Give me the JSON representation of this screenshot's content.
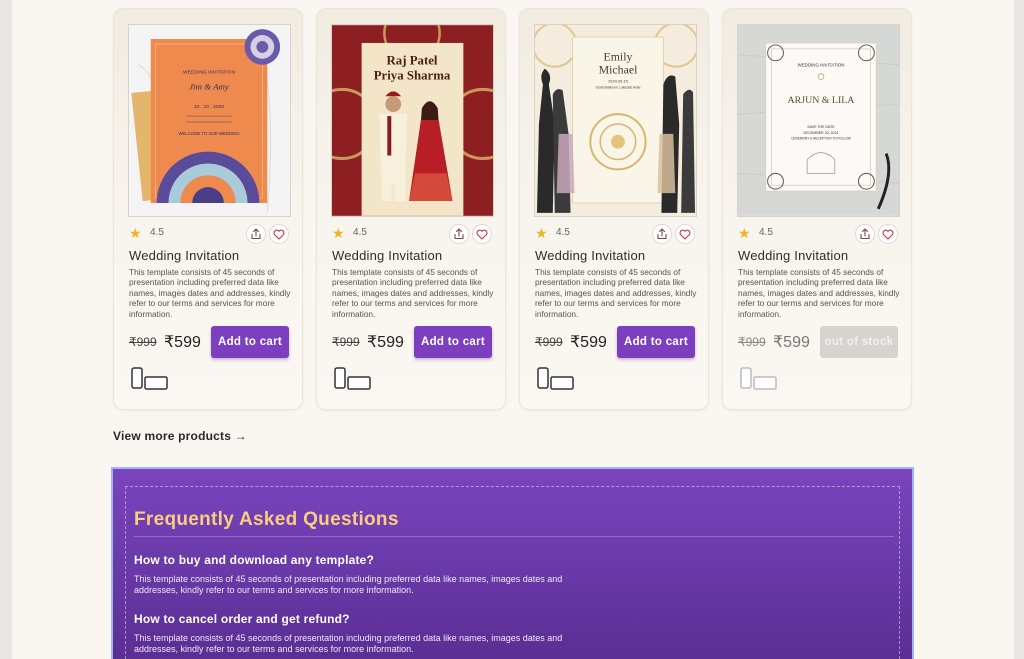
{
  "products": [
    {
      "rating": "4.5",
      "title": "Wedding Invitation",
      "description": "This template consists of 45 seconds of presentation including preferred data like names, images dates and addresses, kindly refer to our terms and services for more information.",
      "old_price": "₹999",
      "price": "₹599",
      "button_label": "Add to cart",
      "available": true,
      "thumb": {
        "heading": "WEDDING INVITATION",
        "names": "Jim & Amy",
        "date": "10 . 10 . 2020",
        "footer": "WELCOME TO OUR WEDDING"
      }
    },
    {
      "rating": "4.5",
      "title": "Wedding Invitation",
      "description": "This template consists of 45 seconds of presentation including preferred data like names, images dates and addresses, kindly refer to our terms and services for more information.",
      "old_price": "₹999",
      "price": "₹599",
      "button_label": "Add to cart",
      "available": true,
      "thumb": {
        "name1": "Raj Patel",
        "name2": "Priya Sharma"
      }
    },
    {
      "rating": "4.5",
      "title": "Wedding Invitation",
      "description": "This template consists of 45 seconds of presentation including preferred data like names, images dates and addresses, kindly refer to our terms and services for more information.",
      "old_price": "₹999",
      "price": "₹599",
      "button_label": "Add to cart",
      "available": true,
      "thumb": {
        "name1": "Emily",
        "name2": "Michael",
        "date": "2024.09.15",
        "venue": "Grand Ballroom, Lakeside Hotel"
      }
    },
    {
      "rating": "4.5",
      "title": "Wedding Invitation",
      "description": "This template consists of 45 seconds of presentation including preferred data like names, images dates and addresses, kindly refer to our terms and services for more information.",
      "old_price": "₹999",
      "price": "₹599",
      "button_label": "out of stock",
      "available": false,
      "thumb": {
        "heading": "WEDDING INVITATION",
        "names": "ARJUN & LILA",
        "line1": "SAVE THE DATE",
        "line2": "DECEMBER 20, 2024",
        "line3": "CEREMONY & RECEPTION TO FOLLOW"
      }
    }
  ],
  "view_more_label": "View more products →",
  "faq": {
    "title": "Frequently Asked Questions",
    "items": [
      {
        "question": "How to buy and download any template?",
        "answer": "This template consists of 45 seconds of presentation including preferred data like names, images dates and addresses, kindly refer to our terms and services for more information."
      },
      {
        "question": "How to cancel order and get refund?",
        "answer": "This template consists of 45 seconds of presentation including preferred data like names, images dates and addresses, kindly refer to our terms and services for more information."
      }
    ]
  },
  "icons": {
    "rating": "star-icon",
    "share": "share-icon",
    "wishlist": "heart-icon",
    "devices": "phone-and-tablet-icon"
  },
  "colors": {
    "accent": "#7b3fbf",
    "star": "#f0b323",
    "faq_title": "#f7cf7e",
    "disabled_button": "#d7d3cf"
  }
}
